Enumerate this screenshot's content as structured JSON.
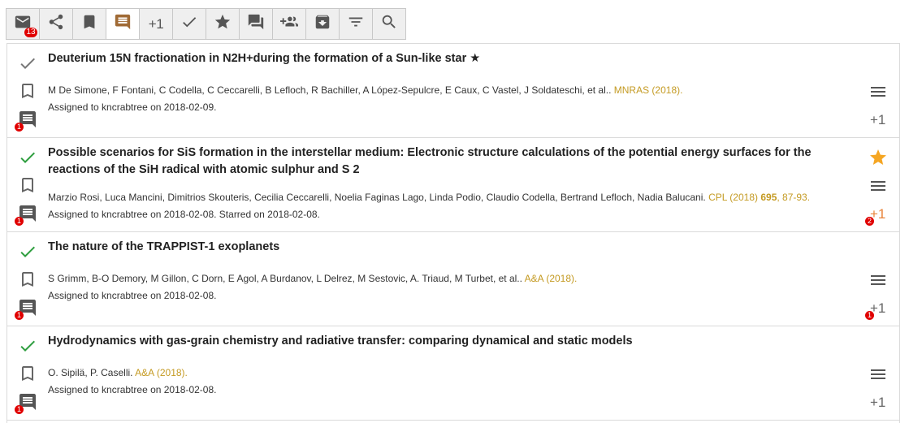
{
  "toolbar": {
    "mail_badge": "13",
    "plus_label": "+1"
  },
  "entries": [
    {
      "title": "Deuterium 15N fractionation in N2H+during the formation of a Sun-like star ★",
      "authors": "M De Simone, F Fontani, C Codella, C Ceccarelli, B Lefloch, R Bachiller, A López-Sepulcre, E Caux, C Vastel, J Soldateschi, et al.. ",
      "journal": "MNRAS (2018).",
      "assigned": "Assigned to kncrabtree on 2018-02-09.",
      "checked": "grey",
      "starred": false,
      "comment_count": "1",
      "plus_label": "+1",
      "plus_count": ""
    },
    {
      "title": "Possible scenarios for SiS formation in the interstellar medium: Electronic structure calculations of the potential energy surfaces for the reactions of the SiH radical with atomic sulphur and S 2",
      "authors": "Marzio Rosi, Luca Mancini, Dimitrios Skouteris, Cecilia Ceccarelli, Noelia Faginas Lago, Linda Podio, Claudio Codella, Bertrand Lefloch, Nadia Balucani. ",
      "journal": "CPL (2018) ",
      "journal_volume": "695",
      "journal_pages": ", 87-93.",
      "assigned": "Assigned to kncrabtree on 2018-02-08. Starred on 2018-02-08.",
      "checked": "green",
      "starred": true,
      "comment_count": "1",
      "plus_label": "+1",
      "plus_count": "2"
    },
    {
      "title": "The nature of the TRAPPIST-1 exoplanets",
      "authors": "S Grimm, B-O Demory, M Gillon, C Dorn, E Agol, A Burdanov, L Delrez, M Sestovic, A. Triaud, M Turbet, et al.. ",
      "journal": "A&A (2018).",
      "assigned": "Assigned to kncrabtree on 2018-02-08.",
      "checked": "green",
      "starred": false,
      "comment_count": "1",
      "plus_label": "+1",
      "plus_count": "1"
    },
    {
      "title": "Hydrodynamics with gas-grain chemistry and radiative transfer: comparing dynamical and static models",
      "authors": "O. Sipilä, P. Caselli. ",
      "journal": "A&A (2018).",
      "assigned": "Assigned to kncrabtree on 2018-02-08.",
      "checked": "green",
      "starred": false,
      "comment_count": "1",
      "plus_label": "+1",
      "plus_count": ""
    }
  ],
  "colors": {
    "journal": "#c49a22",
    "check_green": "#2e9e3f",
    "check_grey": "#777777",
    "star": "#f5a623",
    "plus_orange": "#e8843a",
    "badge_red": "#e00000",
    "comment_active": "#a06a35"
  }
}
